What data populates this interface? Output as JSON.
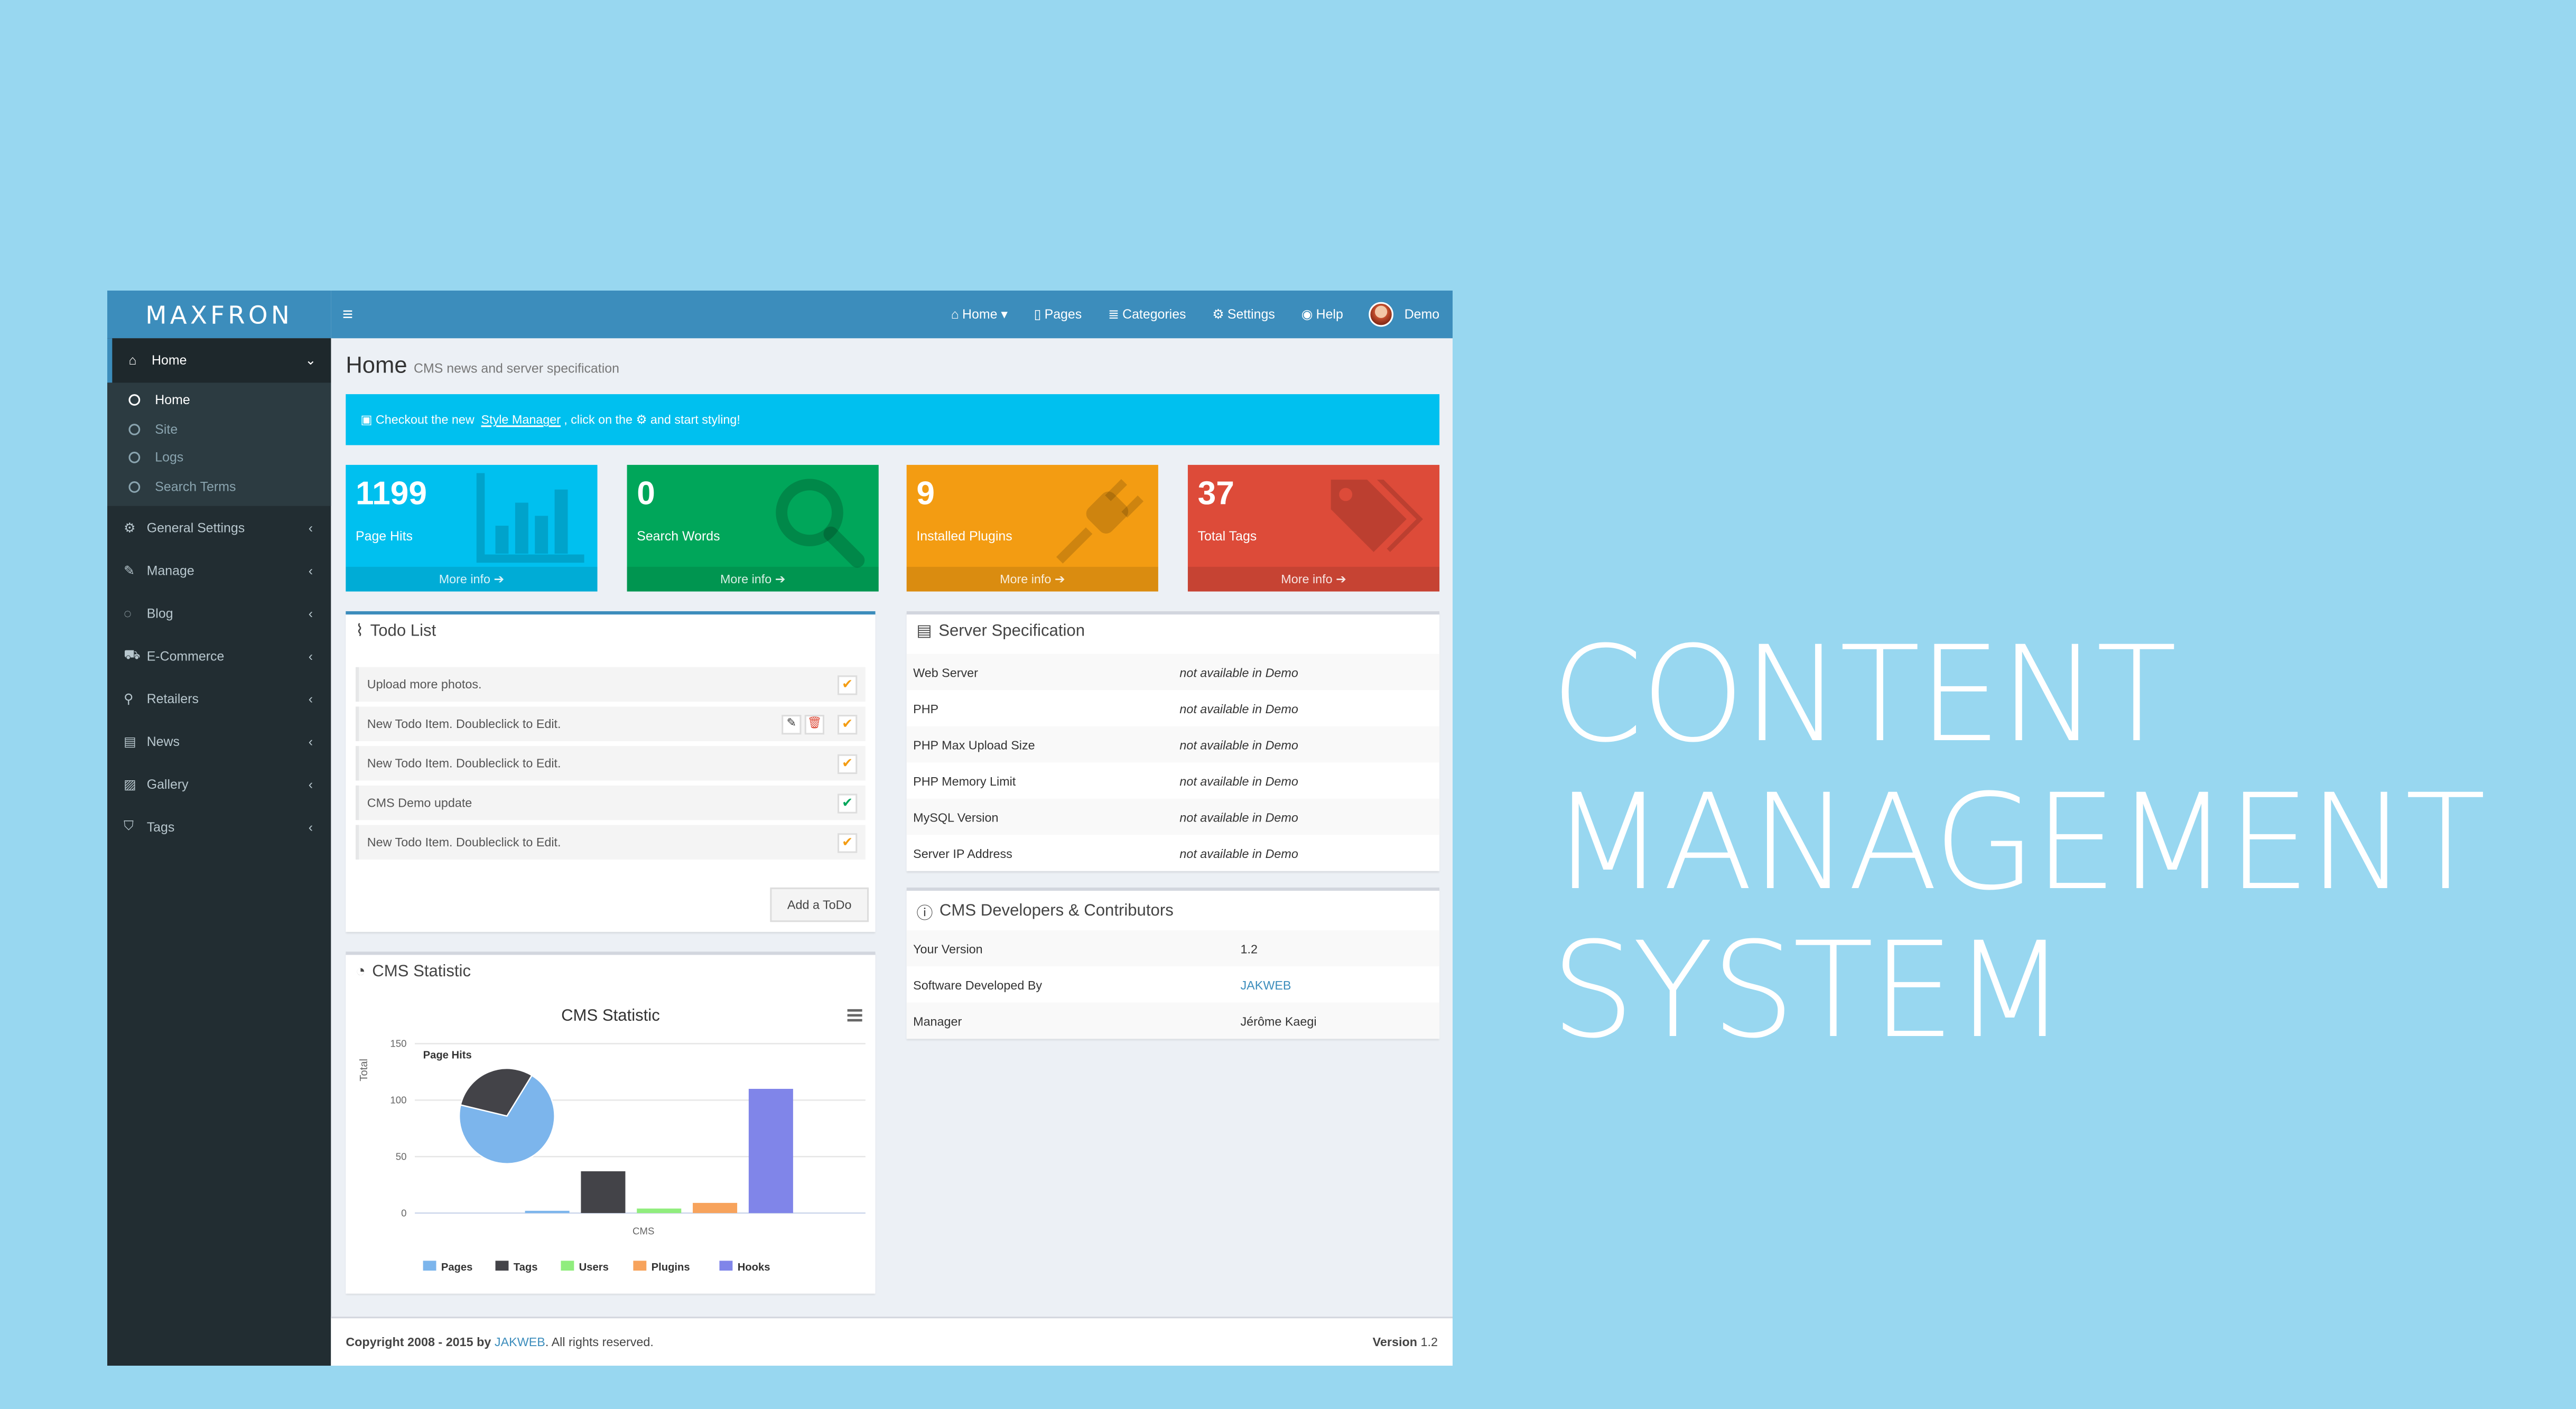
{
  "tagline": [
    "CONTENT",
    "MANAGEMENT",
    "SYSTEM"
  ],
  "brand": "MAXFRON",
  "colors": {
    "background": "#98d7f0",
    "header": "#3c8dbc",
    "sidebar": "#222d32",
    "aqua": "#00c0ef",
    "green": "#00a65a",
    "yellow": "#f39c12",
    "red": "#dd4b39"
  },
  "topnav": [
    {
      "icon": "home-icon",
      "glyph": "⌂",
      "label": "Home ▾"
    },
    {
      "icon": "file-icon",
      "glyph": "▯",
      "label": "Pages"
    },
    {
      "icon": "list-icon",
      "glyph": "≣",
      "label": "Categories"
    },
    {
      "icon": "gears-icon",
      "glyph": "⚙",
      "label": "Settings"
    },
    {
      "icon": "help-icon",
      "glyph": "◉",
      "label": "Help"
    }
  ],
  "user": {
    "name": "Demo"
  },
  "sidebar": {
    "header": {
      "label": "Home",
      "icon": "home-icon"
    },
    "sub": [
      {
        "label": "Home",
        "active": true
      },
      {
        "label": "Site"
      },
      {
        "label": "Logs"
      },
      {
        "label": "Search Terms"
      }
    ],
    "items": [
      {
        "label": "General Settings",
        "icon": "gears-icon",
        "glyph": "⚙"
      },
      {
        "label": "Manage",
        "icon": "edit-icon",
        "glyph": "✎"
      },
      {
        "label": "Blog",
        "icon": "comments-icon",
        "glyph": "◌"
      },
      {
        "label": "E-Commerce",
        "icon": "cart-icon",
        "glyph": "⛟"
      },
      {
        "label": "Retailers",
        "icon": "map-marker-icon",
        "glyph": "⚲"
      },
      {
        "label": "News",
        "icon": "newspaper-icon",
        "glyph": "▤"
      },
      {
        "label": "Gallery",
        "icon": "image-icon",
        "glyph": "▨"
      },
      {
        "label": "Tags",
        "icon": "tags-icon",
        "glyph": "⛉"
      }
    ]
  },
  "page": {
    "title": "Home",
    "subtitle": "CMS news and server specification"
  },
  "callout": {
    "pre": "Checkout the new",
    "link": "Style Manager",
    "post": ", click on the ⚙ and start styling!"
  },
  "stats": [
    {
      "value": "1199",
      "label": "Page Hits",
      "color": "#00c0ef",
      "icon": "bar-chart-icon",
      "more": "More info ➔"
    },
    {
      "value": "0",
      "label": "Search Words",
      "color": "#00a65a",
      "icon": "search-icon",
      "more": "More info ➔"
    },
    {
      "value": "9",
      "label": "Installed Plugins",
      "color": "#f39c12",
      "icon": "plug-icon",
      "more": "More info ➔"
    },
    {
      "value": "37",
      "label": "Total Tags",
      "color": "#dd4b39",
      "icon": "tags-icon",
      "more": "More info ➔"
    }
  ],
  "todo": {
    "title": "Todo List",
    "items": [
      {
        "text": "Upload more photos.",
        "done": false,
        "tools": false
      },
      {
        "text": "New Todo Item. Doubleclick to Edit.",
        "done": false,
        "tools": true
      },
      {
        "text": "New Todo Item. Doubleclick to Edit.",
        "done": false,
        "tools": false
      },
      {
        "text": "CMS Demo update",
        "done": true,
        "tools": false
      },
      {
        "text": "New Todo Item. Doubleclick to Edit.",
        "done": false,
        "tools": false
      }
    ],
    "add_label": "Add a ToDo"
  },
  "server": {
    "title": "Server Specification",
    "rows": [
      {
        "k": "Web Server",
        "v": "not available in Demo"
      },
      {
        "k": "PHP",
        "v": "not available in Demo"
      },
      {
        "k": "PHP Max Upload Size",
        "v": "not available in Demo"
      },
      {
        "k": "PHP Memory Limit",
        "v": "not available in Demo"
      },
      {
        "k": "MySQL Version",
        "v": "not available in Demo"
      },
      {
        "k": "Server IP Address",
        "v": "not available in Demo"
      }
    ]
  },
  "devs": {
    "title": "CMS Developers & Contributors",
    "rows": [
      {
        "k": "Your Version",
        "v": "1.2"
      },
      {
        "k": "Software Developed By",
        "v": "JAKWEB",
        "link": true
      },
      {
        "k": "Manager",
        "v": "Jérôme Kaegi"
      }
    ]
  },
  "chart_data": {
    "panel_title": "CMS Statistic",
    "title": "CMS Statistic",
    "type": "bar",
    "ylabel": "Total",
    "xlabel": "CMS",
    "ylim": [
      0,
      150
    ],
    "yticks": [
      0,
      50,
      100,
      150
    ],
    "pie_label": "Page Hits",
    "series": [
      {
        "name": "Pages",
        "value": 2,
        "color": "#7cb5ec"
      },
      {
        "name": "Tags",
        "value": 37,
        "color": "#434348"
      },
      {
        "name": "Users",
        "value": 4,
        "color": "#90ed7d"
      },
      {
        "name": "Plugins",
        "value": 9,
        "color": "#f7a35c"
      },
      {
        "name": "Hooks",
        "value": 110,
        "color": "#8085e9"
      }
    ],
    "pie": [
      {
        "name": "Pages",
        "value": 70,
        "color": "#7cb5ec"
      },
      {
        "name": "Tags",
        "value": 30,
        "color": "#434348"
      }
    ]
  },
  "footer": {
    "copyright": "Copyright 2008 - 2015 by",
    "company": "JAKWEB",
    "rights": ". All rights reserved.",
    "version_label": "Version",
    "version": "1.2"
  }
}
